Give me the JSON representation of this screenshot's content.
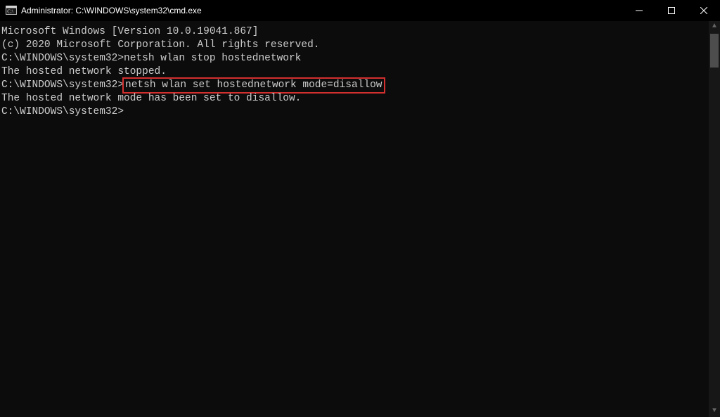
{
  "titlebar": {
    "title": "Administrator: C:\\WINDOWS\\system32\\cmd.exe"
  },
  "console": {
    "line1": "Microsoft Windows [Version 10.0.19041.867]",
    "line2": "(c) 2020 Microsoft Corporation. All rights reserved.",
    "blank1": "",
    "prompt1_path": "C:\\WINDOWS\\system32>",
    "prompt1_cmd": "netsh wlan stop hostednetwork",
    "response1": "The hosted network stopped.",
    "blank2": "",
    "blank3": "",
    "prompt2_path": "C:\\WINDOWS\\system32>",
    "prompt2_cmd": "netsh wlan set hostednetwork mode=disallow",
    "response2": "The hosted network mode has been set to disallow.",
    "blank4": "",
    "blank5": "",
    "prompt3_path": "C:\\WINDOWS\\system32>"
  }
}
